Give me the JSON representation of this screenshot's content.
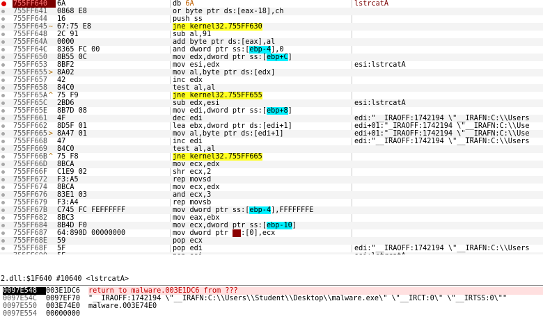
{
  "disassembly": [
    {
      "addr": "755FF640",
      "bytes": "6A",
      "instr": "db 6A",
      "comment": "lstrcatA",
      "bp": true,
      "jmp": "",
      "style": "db"
    },
    {
      "addr": "755FF641",
      "bytes": "0868 E8",
      "instr": "or byte ptr ds:[eax-18],ch",
      "comment": "",
      "jmp": ""
    },
    {
      "addr": "755FF644",
      "bytes": "16",
      "instr": "push ss",
      "comment": "",
      "jmp": ""
    },
    {
      "addr": "755FF645",
      "bytes": "67:75 E8",
      "instr": "jne kernel32.755FF630",
      "comment": "",
      "jmp": "~",
      "style": "jmp"
    },
    {
      "addr": "755FF648",
      "bytes": "2C 91",
      "instr": "sub al,91",
      "comment": "",
      "jmp": ""
    },
    {
      "addr": "755FF64A",
      "bytes": "0000",
      "instr": "add byte ptr ds:[eax],al",
      "comment": "",
      "jmp": ""
    },
    {
      "addr": "755FF64C",
      "bytes": "8365 FC 00",
      "instr": "and dword ptr ss:[ebp-4],0",
      "comment": "",
      "jmp": "",
      "style": "cyanref",
      "pre": "and dword ptr ss:[",
      "hl": "ebp-4",
      "post": "],0"
    },
    {
      "addr": "755FF650",
      "bytes": "8B55 0C",
      "instr": "mov edx,dword ptr ss:[ebp+C]",
      "comment": "",
      "jmp": "",
      "style": "cyanref",
      "pre": "mov edx,dword ptr ss:[",
      "hl": "ebp+C",
      "post": "]"
    },
    {
      "addr": "755FF653",
      "bytes": "8BF2",
      "instr": "mov esi,edx",
      "comment": "esi:lstrcatA",
      "jmp": ""
    },
    {
      "addr": "755FF655",
      "bytes": "8A02",
      "instr": "mov al,byte ptr ds:[edx]",
      "comment": "",
      "jmp": ">"
    },
    {
      "addr": "755FF657",
      "bytes": "42",
      "instr": "inc edx",
      "comment": "",
      "jmp": ""
    },
    {
      "addr": "755FF658",
      "bytes": "84C0",
      "instr": "test al,al",
      "comment": "",
      "jmp": ""
    },
    {
      "addr": "755FF65A",
      "bytes": "75 F9",
      "instr": "jne kernel32.755FF655",
      "comment": "",
      "jmp": "^",
      "style": "jmp"
    },
    {
      "addr": "755FF65C",
      "bytes": "2BD6",
      "instr": "sub edx,esi",
      "comment": "esi:lstrcatA",
      "jmp": ""
    },
    {
      "addr": "755FF65E",
      "bytes": "8B7D 08",
      "instr": "mov edi,dword ptr ss:[ebp+8]",
      "comment": "",
      "jmp": "",
      "style": "cyanref",
      "pre": "mov edi,dword ptr ss:[",
      "hl": "ebp+8",
      "post": "]"
    },
    {
      "addr": "755FF661",
      "bytes": "4F",
      "instr": "dec edi",
      "comment": "edi:\"__IRAOFF:1742194 \\\"__IRAFN:C:\\\\Users",
      "jmp": ""
    },
    {
      "addr": "755FF662",
      "bytes": "8D5F 01",
      "instr": "lea ebx,dword ptr ds:[edi+1]",
      "comment": "edi+01:\"_IRAOFF:1742194 \\\"__IRAFN:C:\\\\Use",
      "jmp": ""
    },
    {
      "addr": "755FF665",
      "bytes": "8A47 01",
      "instr": "mov al,byte ptr ds:[edi+1]",
      "comment": "edi+01:\"_IRAOFF:1742194 \\\"__IRAFN:C:\\\\Use",
      "jmp": ">"
    },
    {
      "addr": "755FF668",
      "bytes": "47",
      "instr": "inc edi",
      "comment": "edi:\"__IRAOFF:1742194 \\\"__IRAFN:C:\\\\Users",
      "jmp": ""
    },
    {
      "addr": "755FF669",
      "bytes": "84C0",
      "instr": "test al,al",
      "comment": "",
      "jmp": ""
    },
    {
      "addr": "755FF66B",
      "bytes": "75 F8",
      "instr": "jne kernel32.755FF665",
      "comment": "",
      "jmp": "^",
      "style": "jmp"
    },
    {
      "addr": "755FF66D",
      "bytes": "8BCA",
      "instr": "mov ecx,edx",
      "comment": "",
      "jmp": ""
    },
    {
      "addr": "755FF66F",
      "bytes": "C1E9 02",
      "instr": "shr ecx,2",
      "comment": "",
      "jmp": ""
    },
    {
      "addr": "755FF672",
      "bytes": "F3:A5",
      "instr": "rep movsd",
      "comment": "",
      "jmp": ""
    },
    {
      "addr": "755FF674",
      "bytes": "8BCA",
      "instr": "mov ecx,edx",
      "comment": "",
      "jmp": ""
    },
    {
      "addr": "755FF676",
      "bytes": "83E1 03",
      "instr": "and ecx,3",
      "comment": "",
      "jmp": ""
    },
    {
      "addr": "755FF679",
      "bytes": "F3:A4",
      "instr": "rep movsb",
      "comment": "",
      "jmp": ""
    },
    {
      "addr": "755FF67B",
      "bytes": "C745 FC FEFFFFFF",
      "instr": "mov dword ptr ss:[ebp-4],FFFFFFFE",
      "comment": "",
      "jmp": "",
      "style": "cyanref",
      "pre": "mov dword ptr ss:[",
      "hl": "ebp-4",
      "post": "],FFFFFFFE"
    },
    {
      "addr": "755FF682",
      "bytes": "8BC3",
      "instr": "mov eax,ebx",
      "comment": "",
      "jmp": ""
    },
    {
      "addr": "755FF684",
      "bytes": "8B4D F0",
      "instr": "mov ecx,dword ptr ss:[ebp-10]",
      "comment": "",
      "jmp": "",
      "style": "cyanref",
      "pre": "mov ecx,dword ptr ss:[",
      "hl": "ebp-10",
      "post": "]"
    },
    {
      "addr": "755FF687",
      "bytes": "64:890D 00000000",
      "instr": "mov dword ptr fs:[0],ecx",
      "comment": "",
      "jmp": "",
      "style": "fsref",
      "pre": "mov dword ptr ",
      "hl": "fs",
      "post": ":[0],ecx"
    },
    {
      "addr": "755FF68E",
      "bytes": "59",
      "instr": "pop ecx",
      "comment": "",
      "jmp": ""
    },
    {
      "addr": "755FF68F",
      "bytes": "5F",
      "instr": "pop edi",
      "comment": "edi:\"__IRAOFF:1742194 \\\"__IRAFN:C:\\\\Users",
      "jmp": ""
    },
    {
      "addr": "755FF690",
      "bytes": "5E",
      "instr": "pop esi",
      "comment": "esi:lstrcatA",
      "jmp": ""
    },
    {
      "addr": "755FF691",
      "bytes": "5B",
      "instr": "pop ebx",
      "comment": "",
      "jmp": ""
    }
  ],
  "status_line": "2.dll:$1F640 #10640 <lstrcatA>",
  "stack": [
    {
      "addr": "0097E548",
      "value": "003E1DC6",
      "comment": "return to malware.003E1DC6 from ???",
      "selected": true
    },
    {
      "addr": "0097E54C",
      "value": "0097EF70",
      "comment": "\"__IRAOFF:1742194 \\\"__IRAFN:C:\\\\Users\\\\Student\\\\Desktop\\\\malware.exe\\\" \\\"__IRCT:0\\\" \\\"__IRTSS:0\\\"\"",
      "selected": false
    },
    {
      "addr": "0097E550",
      "value": "003E74E0",
      "comment": "malware.003E74E0",
      "selected": false
    },
    {
      "addr": "0097E554",
      "value": "00000000",
      "comment": "",
      "selected": false
    }
  ]
}
